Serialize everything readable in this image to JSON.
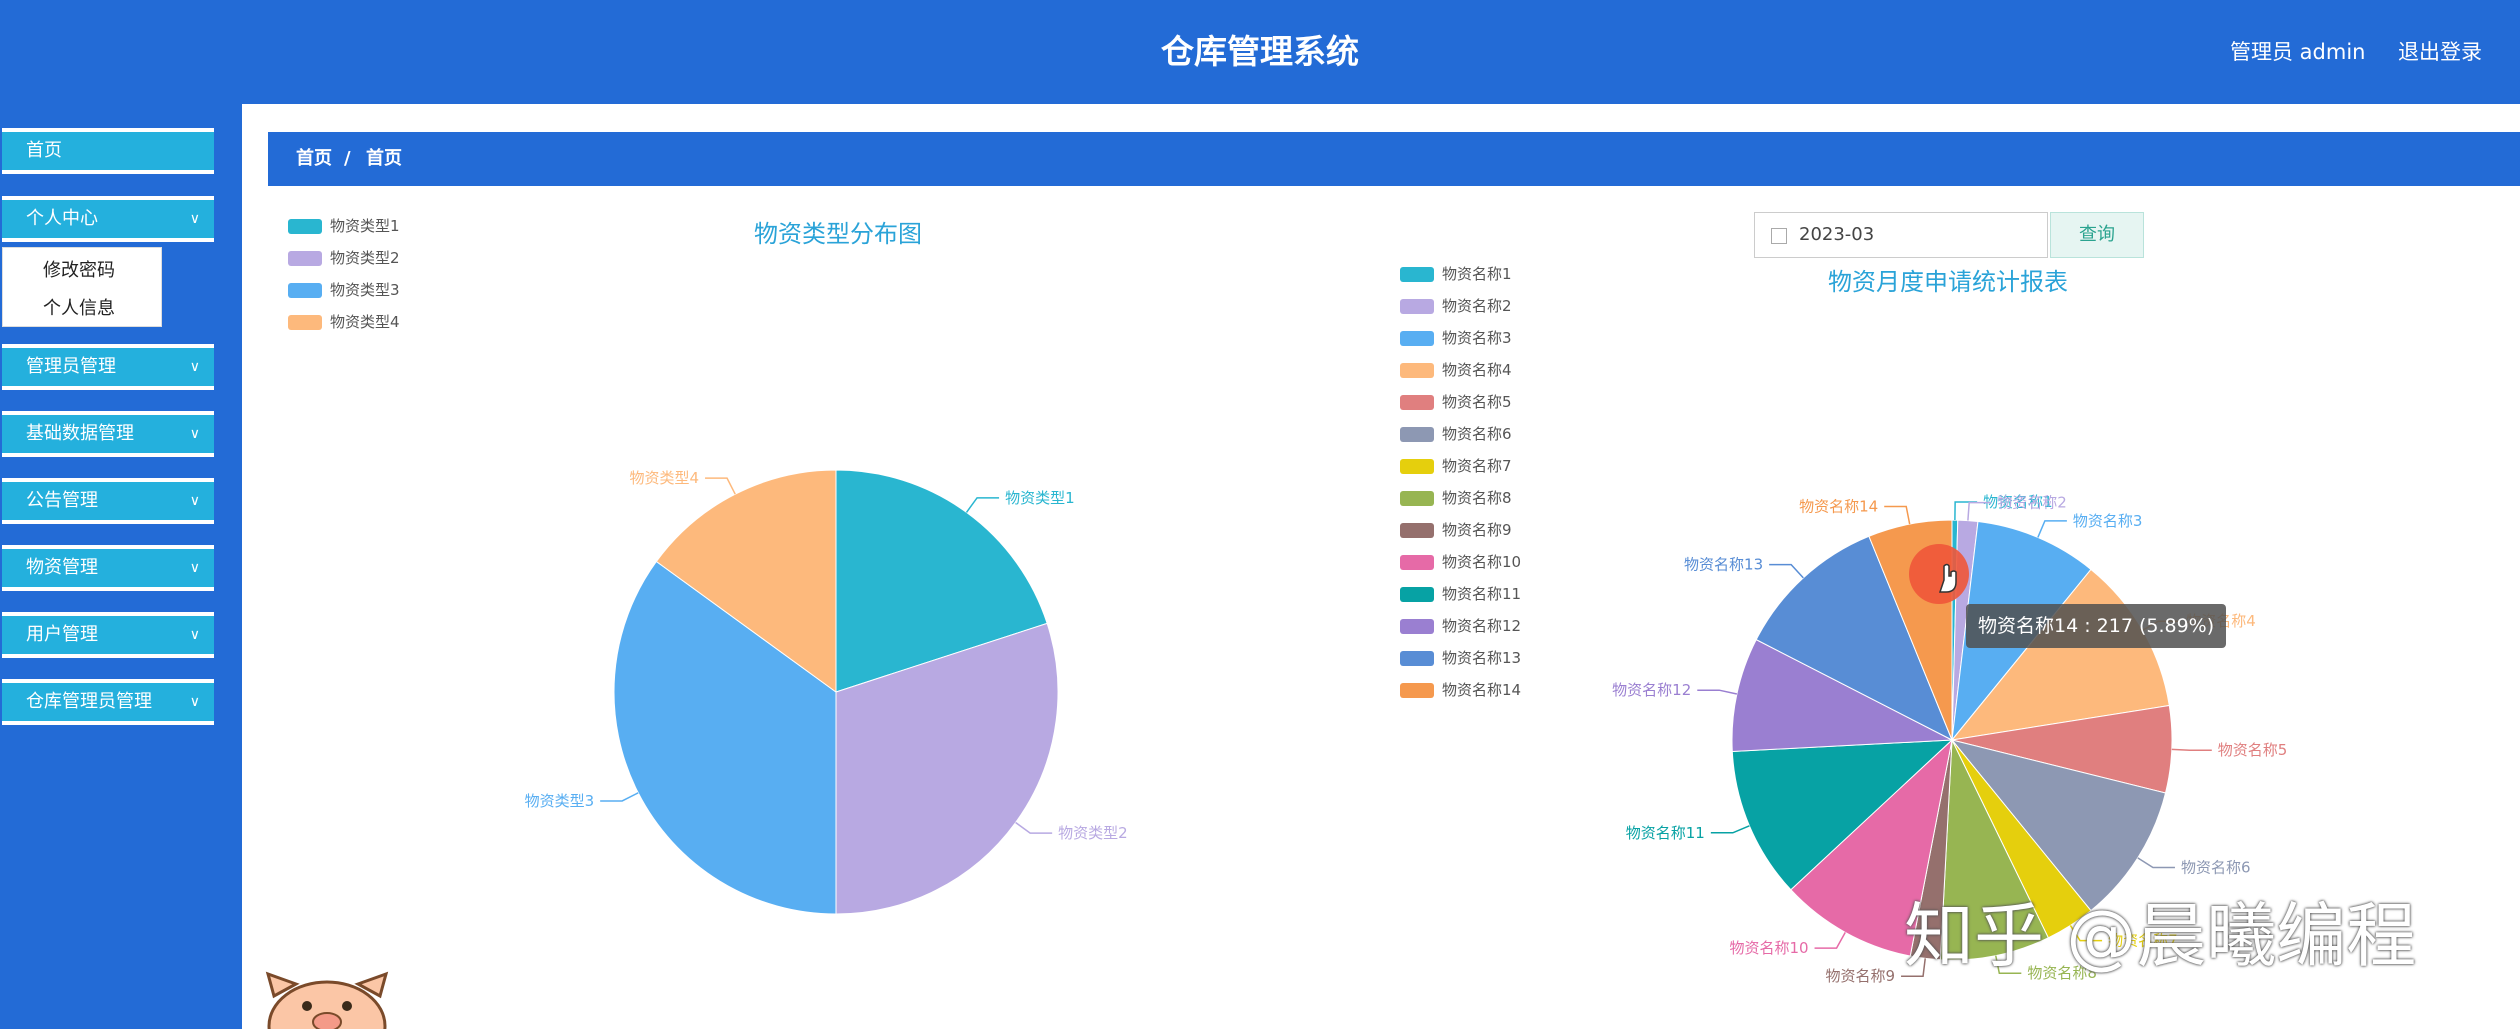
{
  "header": {
    "title": "仓库管理系统",
    "user": "管理员 admin",
    "logout": "退出登录"
  },
  "sidebar": {
    "items": [
      {
        "label": "首页",
        "expandable": false
      },
      {
        "label": "个人中心",
        "expandable": true
      },
      {
        "label": "管理员管理",
        "expandable": true
      },
      {
        "label": "基础数据管理",
        "expandable": true
      },
      {
        "label": "公告管理",
        "expandable": true
      },
      {
        "label": "物资管理",
        "expandable": true
      },
      {
        "label": "用户管理",
        "expandable": true
      },
      {
        "label": "仓库管理员管理",
        "expandable": true
      }
    ],
    "submenu": [
      "修改密码",
      "个人信息"
    ]
  },
  "breadcrumb": {
    "first": "首页",
    "separator": "/",
    "second": "首页"
  },
  "date_query": {
    "value": "2023-03",
    "button": "查询"
  },
  "tooltip": "物资名称14 : 217 (5.89%)",
  "watermark": "知乎 @晨曦编程",
  "chart_data": [
    {
      "type": "pie",
      "title": "物资类型分布图",
      "legend_position": "top-left",
      "series": [
        {
          "name": "物资类型1",
          "value": 20,
          "color": "#29b6d0"
        },
        {
          "name": "物资类型2",
          "value": 30,
          "color": "#b8a9e2"
        },
        {
          "name": "物资类型3",
          "value": 35,
          "color": "#58aef2"
        },
        {
          "name": "物资类型4",
          "value": 15,
          "color": "#fdb97c"
        }
      ]
    },
    {
      "type": "pie",
      "title": "物资月度申请统计报表",
      "legend_position": "top-center",
      "series": [
        {
          "name": "物资名称1",
          "value": 0.4,
          "color": "#29b6d0"
        },
        {
          "name": "物资名称2",
          "value": 1.4,
          "color": "#b8a9e2"
        },
        {
          "name": "物资名称3",
          "value": 8.6,
          "color": "#58aef2"
        },
        {
          "name": "物资名称4",
          "value": 11.1,
          "color": "#fdb97c"
        },
        {
          "name": "物资名称5",
          "value": 6.1,
          "color": "#e07f7f"
        },
        {
          "name": "物资名称6",
          "value": 9.8,
          "color": "#8d98b3"
        },
        {
          "name": "物资名称7",
          "value": 3.5,
          "color": "#e5cf0d"
        },
        {
          "name": "物资名称8",
          "value": 7.7,
          "color": "#97b552"
        },
        {
          "name": "物资名称9",
          "value": 2.1,
          "color": "#95706d"
        },
        {
          "name": "物资名称10",
          "value": 9.6,
          "color": "#e66aa7"
        },
        {
          "name": "物资名称11",
          "value": 10.6,
          "color": "#07a2a4"
        },
        {
          "name": "物资名称12",
          "value": 8.0,
          "color": "#9a7fd1"
        },
        {
          "name": "物资名称13",
          "value": 10.8,
          "color": "#588dd5"
        },
        {
          "name": "物资名称14",
          "value": 5.89,
          "color": "#f5994e"
        }
      ]
    }
  ]
}
